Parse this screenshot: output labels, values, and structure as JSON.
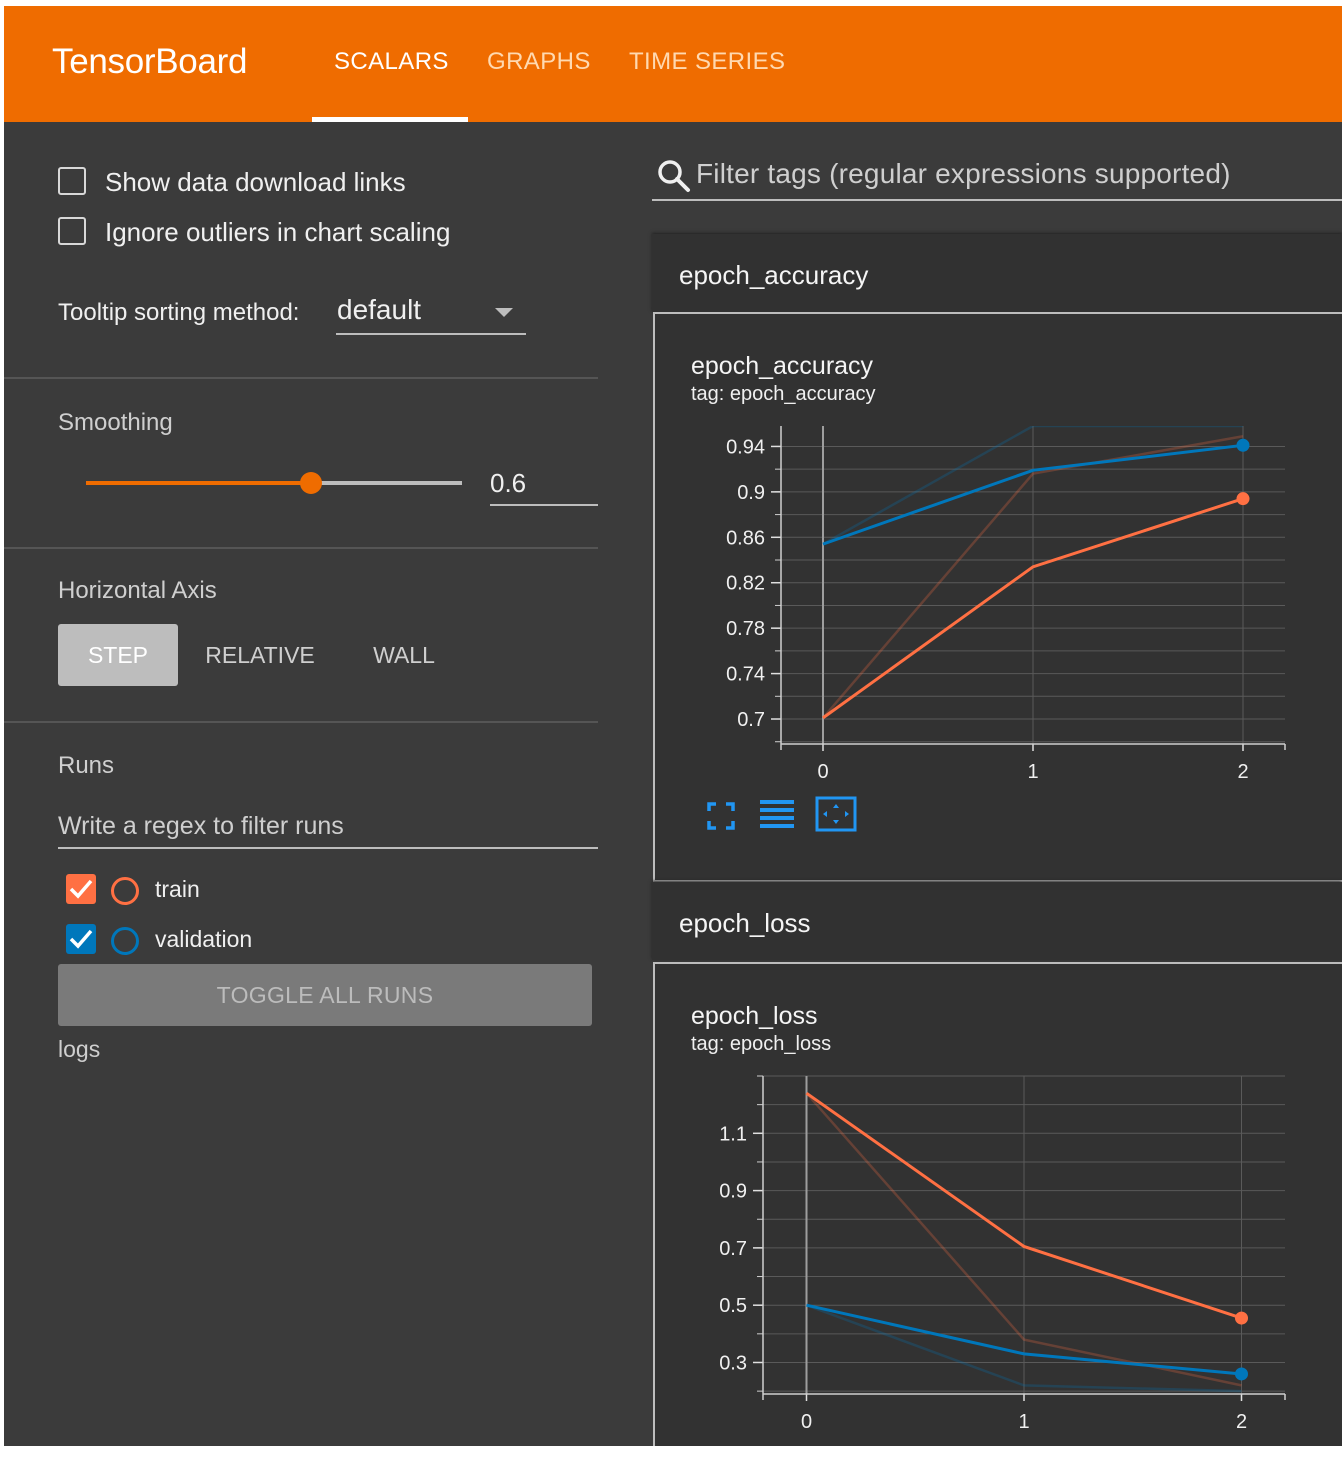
{
  "header": {
    "brand": "TensorBoard",
    "tabs": [
      {
        "label": "SCALARS",
        "active": true
      },
      {
        "label": "GRAPHS",
        "active": false
      },
      {
        "label": "TIME SERIES",
        "active": false
      }
    ],
    "color": "#ef6c00"
  },
  "sidebar": {
    "options": [
      {
        "label": "Show data download links",
        "checked": false
      },
      {
        "label": "Ignore outliers in chart scaling",
        "checked": false
      }
    ],
    "tooltip_sorting": {
      "label": "Tooltip sorting method:",
      "value": "default"
    },
    "smoothing": {
      "title": "Smoothing",
      "value": "0.6",
      "fraction": 0.6
    },
    "horizontal_axis": {
      "title": "Horizontal Axis",
      "options": [
        "STEP",
        "RELATIVE",
        "WALL"
      ],
      "selected": "STEP"
    },
    "runs": {
      "title": "Runs",
      "filter_placeholder": "Write a regex to filter runs",
      "items": [
        {
          "name": "train",
          "checked": true,
          "color": "#ff7043"
        },
        {
          "name": "validation",
          "checked": true,
          "color": "#0077bb"
        }
      ],
      "toggle_label": "TOGGLE ALL RUNS",
      "logdir": "logs"
    }
  },
  "main": {
    "filter_placeholder": "Filter tags (regular expressions supported)",
    "groups": [
      {
        "title": "epoch_accuracy",
        "card_title": "epoch_accuracy",
        "card_tag": "tag: epoch_accuracy"
      },
      {
        "title": "epoch_loss",
        "card_title": "epoch_loss",
        "card_tag": "tag: epoch_loss"
      }
    ],
    "icons": [
      "fullscreen-icon",
      "toggle-log-scale-icon",
      "fit-domain-icon"
    ]
  },
  "chart_data": [
    {
      "type": "line",
      "title": "epoch_accuracy",
      "x": [
        0,
        1,
        2
      ],
      "x_ticks": [
        "0",
        "1",
        "2"
      ],
      "y_ticks": [
        "0.94",
        "0.9",
        "0.86",
        "0.82",
        "0.78",
        "0.74",
        "0.7"
      ],
      "ylim": [
        0.678,
        0.958
      ],
      "xlim": [
        -0.2,
        2.2
      ],
      "series": [
        {
          "name": "train",
          "color": "#ff7043",
          "raw": [
            0.701,
            0.916,
            0.949
          ],
          "smoothed": [
            0.701,
            0.834,
            0.894
          ]
        },
        {
          "name": "validation",
          "color": "#0077bb",
          "raw": [
            0.854,
            0.958,
            0.958
          ],
          "smoothed": [
            0.854,
            0.919,
            0.941
          ]
        }
      ]
    },
    {
      "type": "line",
      "title": "epoch_loss",
      "x": [
        0,
        1,
        2
      ],
      "x_ticks": [
        "0",
        "1",
        "2"
      ],
      "y_ticks": [
        "1.1",
        "0.9",
        "0.7",
        "0.5",
        "0.3"
      ],
      "ylim": [
        0.19,
        1.3
      ],
      "xlim": [
        -0.2,
        2.2
      ],
      "series": [
        {
          "name": "train",
          "color": "#ff7043",
          "raw": [
            1.24,
            0.38,
            0.22
          ],
          "smoothed": [
            1.24,
            0.705,
            0.455
          ]
        },
        {
          "name": "validation",
          "color": "#0077bb",
          "raw": [
            0.5,
            0.22,
            0.2
          ],
          "smoothed": [
            0.5,
            0.33,
            0.26
          ]
        }
      ]
    }
  ]
}
